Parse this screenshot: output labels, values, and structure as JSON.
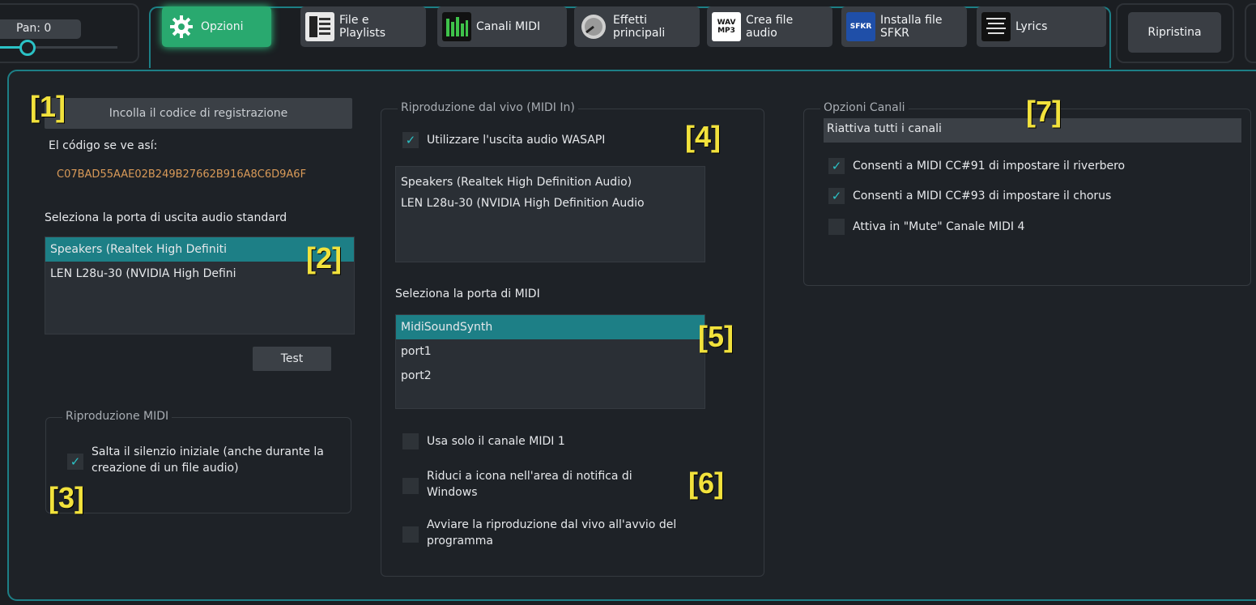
{
  "pan": {
    "label": "Pan: 0",
    "value": 0
  },
  "toolbar": {
    "buttons": [
      {
        "label": "Opzioni",
        "icon": "gear-icon",
        "active": true
      },
      {
        "label": "File e\nPlaylists",
        "icon": "file-playlist-icon"
      },
      {
        "label": "Canali MIDI",
        "icon": "midi-channels-icon"
      },
      {
        "label": "Effetti\nprincipali",
        "icon": "effects-knob-icon"
      },
      {
        "label": "Crea file\naudio",
        "icon": "wav-mp3-icon",
        "icon_text": "WAV\nMP3"
      },
      {
        "label": "Installa file\nSFKR",
        "icon": "sfkr-install-icon",
        "icon_text": "SFKR"
      },
      {
        "label": "Lyrics",
        "icon": "lyrics-icon"
      }
    ],
    "reset_label": "Ripristina"
  },
  "registration": {
    "paste_button": "Incolla il codice di registrazione",
    "code_caption": "El código se ve así:",
    "sample_code": "C07BAD55AAE02B249B27662B916A8C6D9A6F"
  },
  "audio_output": {
    "label": "Seleziona la porta di uscita audio standard",
    "devices": [
      "Speakers (Realtek High Definiti",
      "LEN L28u-30 (NVIDIA High Defini"
    ],
    "selected_index": 0,
    "test_button": "Test"
  },
  "midi_playback": {
    "legend": "Riproduzione MIDI",
    "skip_silence": {
      "label": "Salta il silenzio iniziale (anche durante la creazione di un file audio)",
      "checked": true
    }
  },
  "live": {
    "legend": "Riproduzione dal vivo (MIDI In)",
    "wasapi": {
      "label": "Utilizzare l'uscita audio WASAPI",
      "checked": true
    },
    "wasapi_devices": [
      "Speakers (Realtek High Definition Audio)",
      "LEN L28u-30 (NVIDIA High Definition Audio"
    ],
    "midi_port_label": "Seleziona la porta di MIDI",
    "midi_ports": [
      "MidiSoundSynth",
      "port1",
      "port2"
    ],
    "selected_port_index": 0,
    "only_channel1": {
      "label": "Usa solo il canale MIDI 1",
      "checked": false
    },
    "tray": {
      "label": "Riduci a icona nell'area di notifica di Windows",
      "checked": false
    },
    "autostart": {
      "label": "Avviare la riproduzione dal vivo all'avvio del programma",
      "checked": false
    }
  },
  "channels": {
    "legend": "Opzioni Canali",
    "reactivate_button": "Riattiva tutti i canali",
    "cc91": {
      "label": "Consenti a MIDI CC#91 di impostare il riverbero",
      "checked": true
    },
    "cc93": {
      "label": "Consenti a MIDI CC#93 di impostare il chorus",
      "checked": true
    },
    "mute4": {
      "label": "Attiva in \"Mute\" Canale MIDI 4",
      "checked": false
    }
  },
  "markers": [
    "[1]",
    "[2]",
    "[3]",
    "[4]",
    "[5]",
    "[6]",
    "[7]"
  ],
  "colors": {
    "accent": "#1d7f86",
    "active": "#29a96f",
    "check": "#2bc2c6",
    "code": "#d99a58",
    "marker": "#f2e23c"
  }
}
